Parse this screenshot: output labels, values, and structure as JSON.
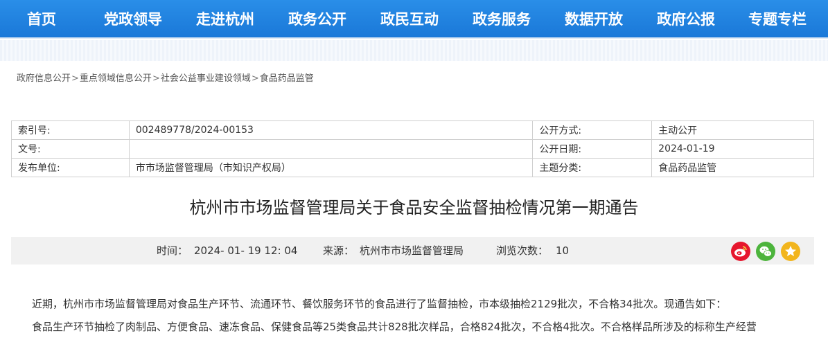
{
  "nav": {
    "items": [
      "首页",
      "党政领导",
      "走进杭州",
      "政务公开",
      "政民互动",
      "政务服务",
      "数据开放",
      "政府公报",
      "专题专栏"
    ]
  },
  "breadcrumb": [
    "政府信息公开",
    "重点领域信息公开",
    "社会公益事业建设领域",
    "食品药品监管"
  ],
  "meta": {
    "index_label": "索引号:",
    "index_value": "002489778/2024-00153",
    "pubmode_label": "公开方式:",
    "pubmode_value": "主动公开",
    "docno_label": "文号:",
    "docno_value": "",
    "pubdate_label": "公开日期:",
    "pubdate_value": "2024-01-19",
    "publisher_label": "发布单位:",
    "publisher_value": "市市场监督管理局（市知识产权局）",
    "topic_label": "主题分类:",
    "topic_value": "食品药品监管"
  },
  "article": {
    "title": "杭州市市场监督管理局关于食品安全监督抽检情况第一期通告",
    "time_label": "时间：",
    "time_value": "2024- 01- 19  12: 04",
    "source_label": "来源：",
    "source_value": "杭州市市场监督管理局",
    "views_label": "浏览次数：",
    "views_value": "10",
    "paragraphs": [
      "近期，杭州市市场监督管理局对食品生产环节、流通环节、餐饮服务环节的食品进行了监督抽检，市本级抽检2129批次，不合格34批次。现通告如下：",
      "食品生产环节抽检了肉制品、方便食品、速冻食品、保健食品等25类食品共计828批次样品，合格824批次，不合格4批次。不合格样品所涉及的标称生产经营"
    ]
  },
  "share": {
    "icons": [
      "weibo-icon",
      "wechat-icon",
      "favorite-star-icon"
    ],
    "colors": {
      "weibo": "#e6162d",
      "wechat": "#4cb43c",
      "favorite": "#f2b51d"
    }
  },
  "colors": {
    "nav_bg": "#1a78d8",
    "infobar_bg": "#f1f1f1"
  }
}
